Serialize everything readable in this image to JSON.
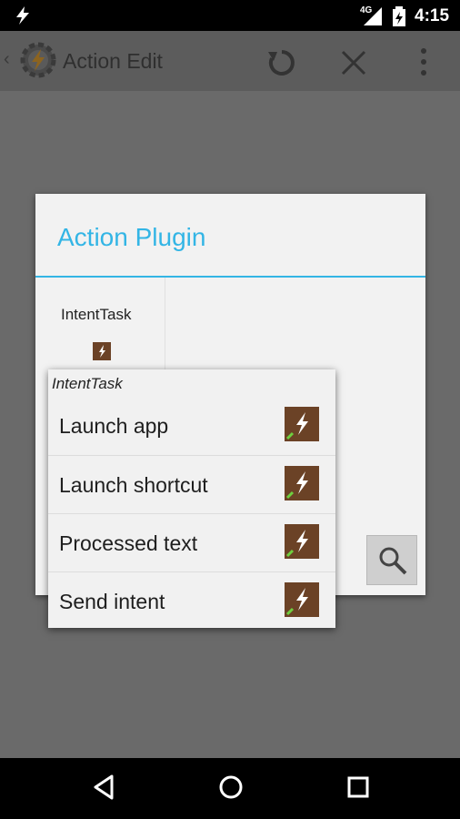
{
  "status_bar": {
    "time": "4:15",
    "network": "4G"
  },
  "action_bar": {
    "title": "Action Edit"
  },
  "dialog": {
    "title": "Action Plugin",
    "plugin_name": "IntentTask"
  },
  "popup": {
    "header": "IntentTask",
    "items": [
      {
        "label": "Launch app"
      },
      {
        "label": "Launch shortcut"
      },
      {
        "label": "Processed text"
      },
      {
        "label": "Send intent"
      }
    ]
  },
  "colors": {
    "accent": "#33b5e5",
    "icon_brown": "#6b4226"
  },
  "icons": [
    "bolt-icon",
    "signal-icon",
    "battery-icon",
    "back-chevron-icon",
    "tasker-icon",
    "undo-icon",
    "close-icon",
    "overflow-menu-icon",
    "search-icon",
    "intenttask-icon",
    "nav-back-icon",
    "nav-home-icon",
    "nav-recents-icon"
  ]
}
